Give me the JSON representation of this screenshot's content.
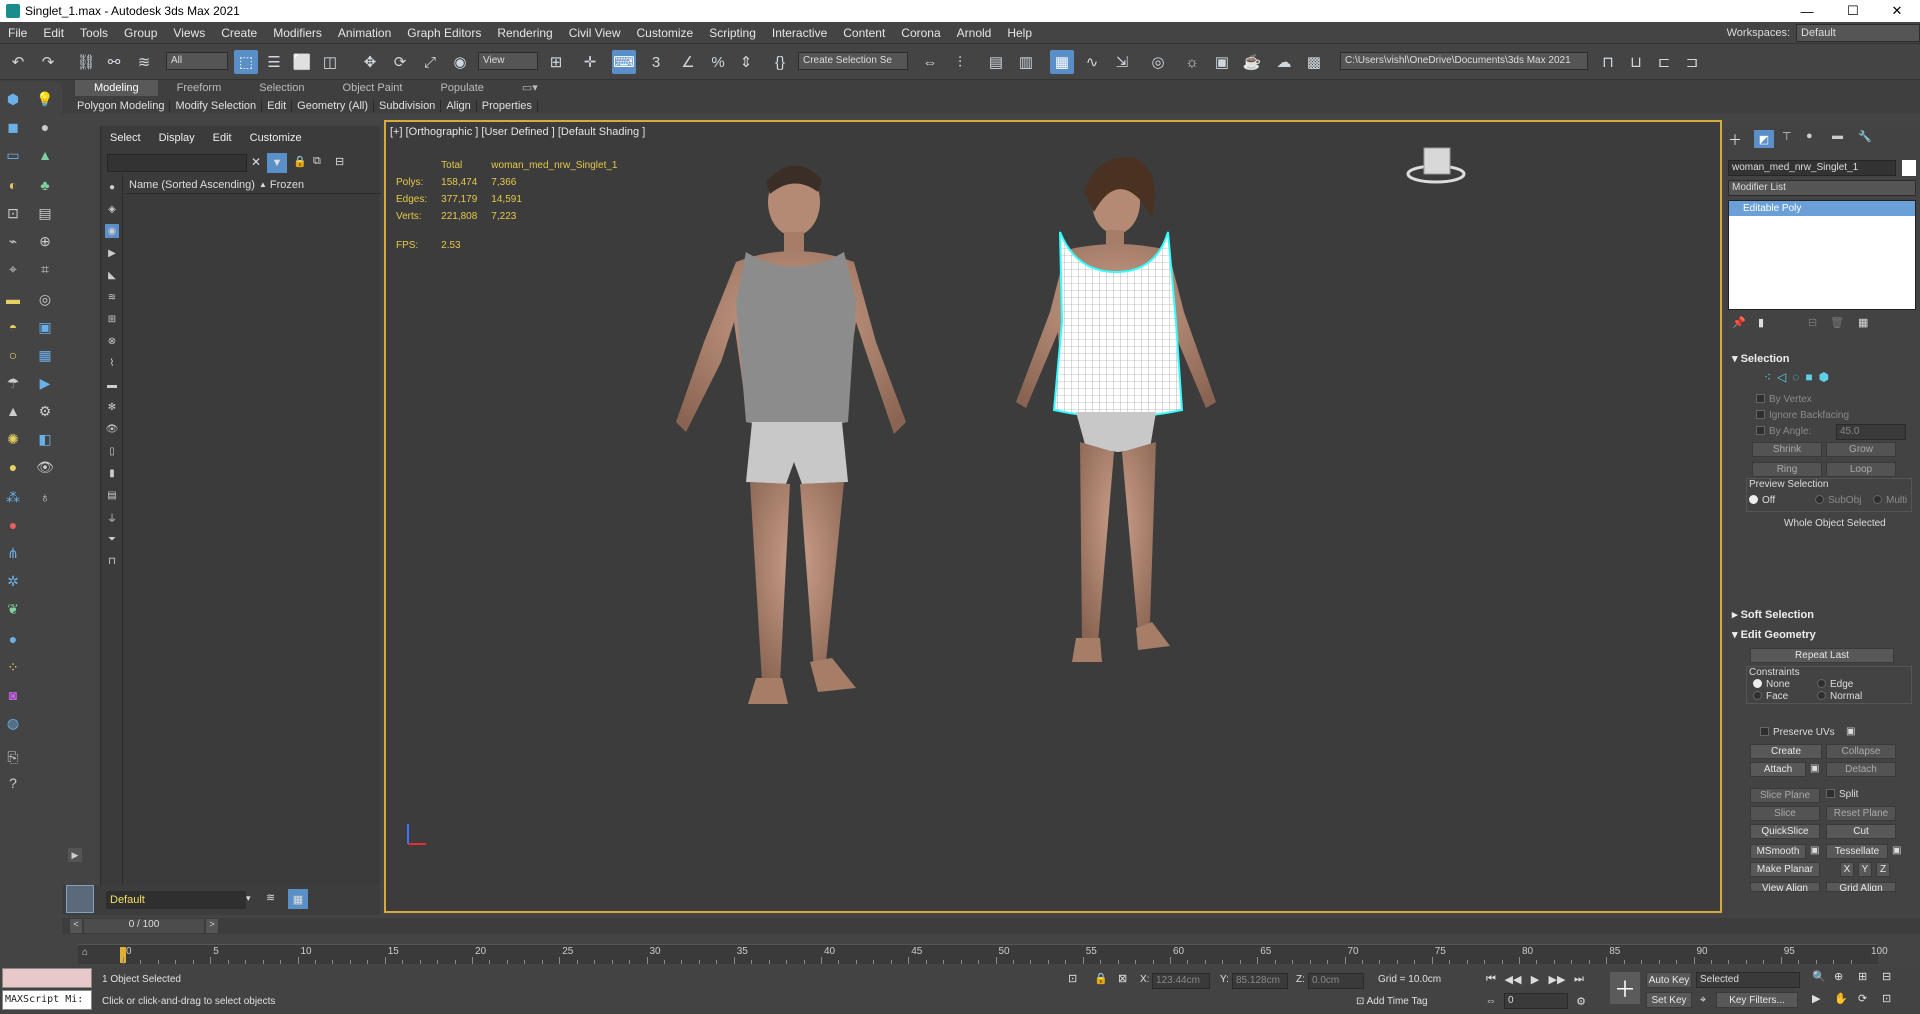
{
  "titlebar": {
    "title": "Singlet_1.max - Autodesk 3ds Max 2021",
    "minimize": "—",
    "maximize": "☐",
    "close": "✕"
  },
  "menu": [
    "File",
    "Edit",
    "Tools",
    "Group",
    "Views",
    "Create",
    "Modifiers",
    "Animation",
    "Graph Editors",
    "Rendering",
    "Civil View",
    "Customize",
    "Scripting",
    "Interactive",
    "Content",
    "Corona",
    "Arnold",
    "Help"
  ],
  "workspaces": {
    "label": "Workspaces:",
    "value": "Default"
  },
  "toolbar": {
    "filter": "All",
    "refcoord": "View",
    "selset": "Create Selection Se",
    "path": "C:\\Users\\vishl\\OneDrive\\Documents\\3ds Max 2021"
  },
  "ribbon": {
    "tabs": [
      "Modeling",
      "Freeform",
      "Selection",
      "Object Paint",
      "Populate"
    ],
    "sub": [
      "Polygon Modeling",
      "Modify Selection",
      "Edit",
      "Geometry (All)",
      "Subdivision",
      "Align",
      "Properties"
    ]
  },
  "scene": {
    "tabs": [
      "Select",
      "Display",
      "Edit",
      "Customize"
    ],
    "col_name": "Name (Sorted Ascending)",
    "col_frozen": "Frozen",
    "sort_arrow": "▲"
  },
  "layer": {
    "value": "Default"
  },
  "viewport": {
    "label": "[+] [Orthographic ] [User Defined ] [Default Shading ]"
  },
  "stats": {
    "h_total": "Total",
    "h_obj": "woman_med_nrw_Singlet_1",
    "polys_l": "Polys:",
    "polys_t": "158,474",
    "polys_o": "7,366",
    "edges_l": "Edges:",
    "edges_t": "377,179",
    "edges_o": "14,591",
    "verts_l": "Verts:",
    "verts_t": "221,808",
    "verts_o": "7,223",
    "fps_l": "FPS:",
    "fps_v": "2.53"
  },
  "cmd": {
    "objname": "woman_med_nrw_Singlet_1",
    "modlist": "Modifier List",
    "stack_item": "Editable Poly",
    "sel": {
      "title": "Selection",
      "byvertex": "By Vertex",
      "ignoreback": "Ignore Backfacing",
      "byangle": "By Angle:",
      "angle": "45.0",
      "shrink": "Shrink",
      "grow": "Grow",
      "ring": "Ring",
      "loop": "Loop",
      "preview": "Preview Selection",
      "off": "Off",
      "subobj": "SubObj",
      "multi": "Multi",
      "whole": "Whole Object Selected"
    },
    "soft": {
      "title": "Soft Selection"
    },
    "edit": {
      "title": "Edit Geometry",
      "repeat": "Repeat Last",
      "constraints": "Constraints",
      "none": "None",
      "edge": "Edge",
      "face": "Face",
      "normal": "Normal",
      "preserve": "Preserve UVs",
      "create": "Create",
      "collapse": "Collapse",
      "attach": "Attach",
      "detach": "Detach",
      "sliceplane": "Slice Plane",
      "split": "Split",
      "slice": "Slice",
      "resetplane": "Reset Plane",
      "quickslice": "QuickSlice",
      "cut": "Cut",
      "msmooth": "MSmooth",
      "tessellate": "Tessellate",
      "makeplanar": "Make Planar",
      "x": "X",
      "y": "Y",
      "z": "Z",
      "viewalign": "View Align",
      "gridalign": "Grid Align"
    }
  },
  "track": {
    "frame": "0 / 100",
    "ticks": [
      "0",
      "5",
      "10",
      "15",
      "20",
      "25",
      "30",
      "35",
      "40",
      "45",
      "50",
      "55",
      "60",
      "65",
      "70",
      "75",
      "80",
      "85",
      "90",
      "95",
      "100"
    ]
  },
  "status": {
    "maxscript": "MAXScript Mi:",
    "selected": "1 Object Selected",
    "prompt": "Click or click-and-drag to select objects",
    "x_l": "X:",
    "x_v": "123.44cm",
    "y_l": "Y:",
    "y_v": "85.128cm",
    "z_l": "Z:",
    "z_v": "0.0cm",
    "grid": "Grid = 10.0cm",
    "addtime": "Add Time Tag",
    "autokey": "Auto Key",
    "setkey": "Set Key",
    "keyset": "Selected",
    "keyfilters": "Key Filters...",
    "curframe": "0"
  }
}
